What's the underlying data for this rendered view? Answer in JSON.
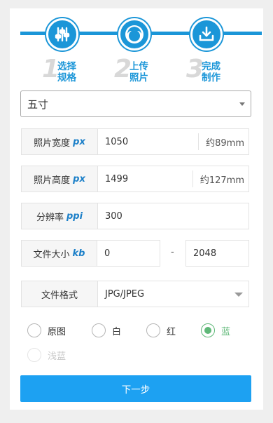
{
  "steps": [
    {
      "number": "1",
      "line1": "选择",
      "line2": "规格"
    },
    {
      "number": "2",
      "line1": "上传",
      "line2": "照片"
    },
    {
      "number": "3",
      "line1": "完成",
      "line2": "制作"
    }
  ],
  "size_select": {
    "value": "五寸"
  },
  "width_row": {
    "label": "照片宽度",
    "unit": "px",
    "value": "1050",
    "suffix": "约89mm"
  },
  "height_row": {
    "label": "照片高度",
    "unit": "px",
    "value": "1499",
    "suffix": "约127mm"
  },
  "dpi_row": {
    "label": "分辨率",
    "unit": "ppi",
    "value": "300"
  },
  "filesize_row": {
    "label": "文件大小",
    "unit": "kb",
    "min": "0",
    "separator": "-",
    "max": "2048"
  },
  "format_row": {
    "label": "文件格式",
    "value": "JPG/JPEG"
  },
  "background_options": [
    {
      "label": "原图",
      "checked": false
    },
    {
      "label": "白",
      "checked": false
    },
    {
      "label": "红",
      "checked": false
    },
    {
      "label": "蓝",
      "checked": true
    },
    {
      "label": "浅蓝",
      "checked": false,
      "disabled": true
    }
  ],
  "next_button": {
    "label": "下一步"
  },
  "colors": {
    "accent": "#1b96d8",
    "button": "#1da1f2",
    "checked": "#5fb878"
  },
  "icons": [
    "sliders-icon",
    "face-upload-icon",
    "download-icon"
  ]
}
